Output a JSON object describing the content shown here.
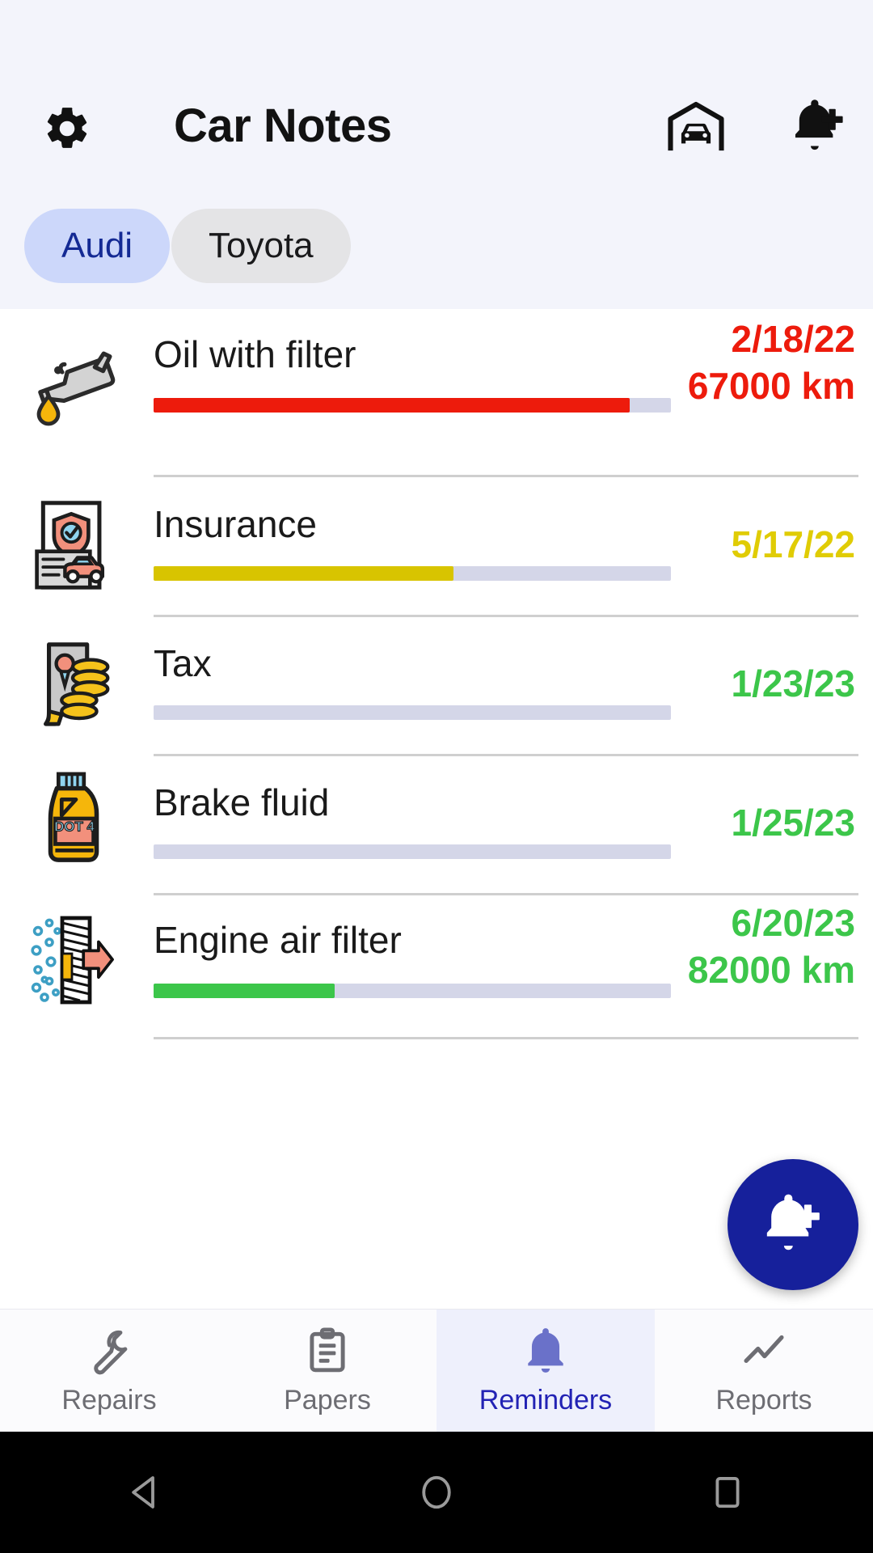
{
  "header": {
    "title": "Car Notes",
    "settings_icon": "gear-icon",
    "garage_icon": "garage-car-icon",
    "add_reminder_icon": "bell-plus-icon",
    "background": "#f3f4fb"
  },
  "car_tabs": {
    "selected_index": 0,
    "items": [
      {
        "label": "Audi",
        "selected": true,
        "bg": "#ccd7fa",
        "fg": "#142a94"
      },
      {
        "label": "Toyota",
        "selected": false,
        "bg": "#e4e4e6",
        "fg": "#19191b"
      }
    ]
  },
  "reminders": [
    {
      "icon": "oil-can-icon",
      "title": "Oil with filter",
      "progress_percent": 92,
      "progress_color": "#ed1b0c",
      "date": "2/18/22",
      "distance": "67000 km",
      "status_color": "#ed1b0c"
    },
    {
      "icon": "insurance-document-icon",
      "title": "Insurance",
      "progress_percent": 58,
      "progress_color": "#d8c400",
      "date": "5/17/22",
      "distance": "",
      "status_color": "#e0cc05"
    },
    {
      "icon": "tax-money-icon",
      "title": "Tax",
      "progress_percent": 0,
      "progress_color": "#3cc64a",
      "date": "1/23/23",
      "distance": "",
      "status_color": "#3cc64a"
    },
    {
      "icon": "brake-fluid-bottle-icon",
      "title": "Brake fluid",
      "progress_percent": 0,
      "progress_color": "#3cc64a",
      "date": "1/25/23",
      "distance": "",
      "status_color": "#3cc64a"
    },
    {
      "icon": "engine-air-filter-icon",
      "title": "Engine air filter",
      "progress_percent": 35,
      "progress_color": "#3cc64a",
      "date": "6/20/23",
      "distance": "82000 km",
      "status_color": "#3cc64a"
    }
  ],
  "fab": {
    "icon": "bell-plus-icon",
    "color": "#16209b"
  },
  "bottom_nav": {
    "active_index": 2,
    "active_color": "#2222b4",
    "inactive_color": "#6d6d73",
    "items": [
      {
        "label": "Repairs",
        "icon": "wrench-icon"
      },
      {
        "label": "Papers",
        "icon": "clipboard-icon"
      },
      {
        "label": "Reminders",
        "icon": "bell-icon"
      },
      {
        "label": "Reports",
        "icon": "line-chart-icon"
      }
    ]
  },
  "system_nav": {
    "items": [
      {
        "label": "Back",
        "icon": "triangle-back-icon"
      },
      {
        "label": "Home",
        "icon": "circle-home-icon"
      },
      {
        "label": "Recents",
        "icon": "square-recents-icon"
      }
    ]
  },
  "progress_track_color": "#d4d6e8"
}
